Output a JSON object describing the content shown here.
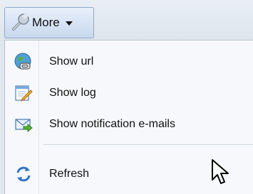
{
  "toolbar": {
    "more_label": "More",
    "wrench_icon": "wrench-icon",
    "caret_icon": "caret-down-icon"
  },
  "menu": {
    "items": [
      {
        "label": "Show url",
        "icon": "globe-link-icon"
      },
      {
        "label": "Show log",
        "icon": "log-edit-icon"
      },
      {
        "label": "Show notification e-mails",
        "icon": "email-arrow-icon"
      },
      {
        "label": "Refresh",
        "icon": "refresh-icon"
      }
    ]
  },
  "colors": {
    "menu_background": "#f6f8fb",
    "button_border": "#8ea8c8",
    "text": "#111111"
  }
}
